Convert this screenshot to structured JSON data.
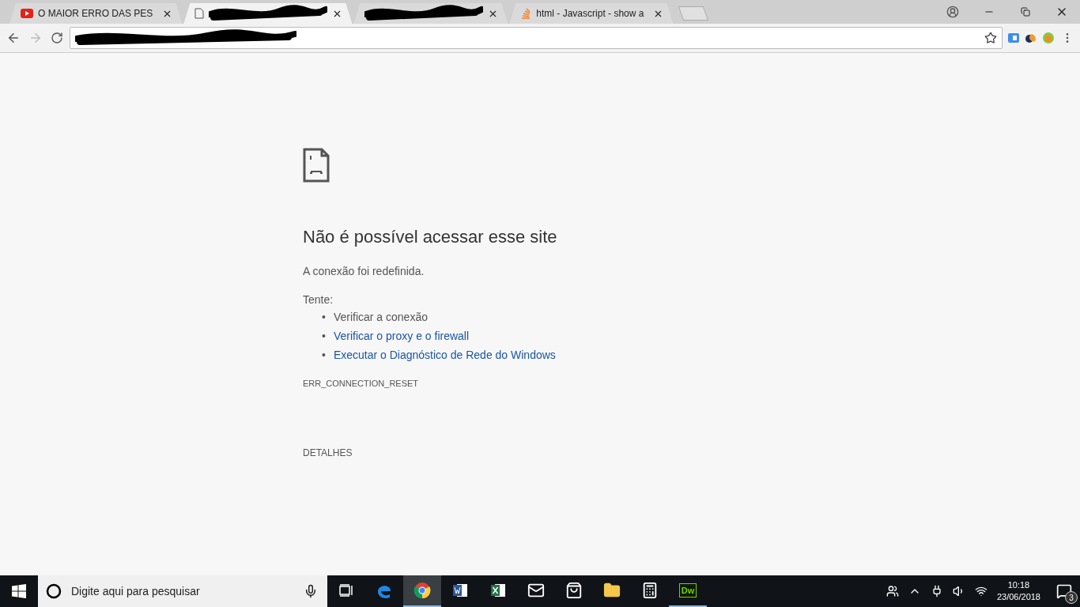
{
  "tabs": [
    {
      "kind": "video",
      "title": "O MAIOR ERRO DAS PES",
      "selected": false
    },
    {
      "kind": "redacted-doc",
      "selected": true
    },
    {
      "kind": "redacted",
      "selected": false
    },
    {
      "kind": "stack",
      "title": "html - Javascript - show a",
      "selected": false
    }
  ],
  "address_bar": {
    "redacted": true
  },
  "error_page": {
    "title": "Não é possível acessar esse site",
    "message": "A conexão foi redefinida.",
    "try_label": "Tente:",
    "suggestions": [
      {
        "kind": "text",
        "marker": "•",
        "text": "Verificar a conexão"
      },
      {
        "kind": "link",
        "marker": "•",
        "text": "Verificar o proxy e o firewall"
      },
      {
        "kind": "link",
        "marker": "•",
        "text": "Executar o Diagnóstico de Rede do Windows"
      }
    ],
    "code": "ERR_CONNECTION_RESET",
    "details_button": "DETALHES"
  },
  "taskbar": {
    "search_placeholder": "Digite aqui para pesquisar",
    "apps": [
      {
        "kind": "taskview",
        "active": false,
        "running": false
      },
      {
        "kind": "edge",
        "active": false,
        "running": false
      },
      {
        "kind": "chrome",
        "active": true,
        "running": true
      },
      {
        "kind": "word",
        "active": false,
        "running": false
      },
      {
        "kind": "excel",
        "active": false,
        "running": false
      },
      {
        "kind": "mail",
        "active": false,
        "running": false
      },
      {
        "kind": "store",
        "active": false,
        "running": false
      },
      {
        "kind": "explorer",
        "active": false,
        "running": false
      },
      {
        "kind": "calculator",
        "active": false,
        "running": false
      },
      {
        "kind": "dreamweaver",
        "label": "Dw",
        "active": false,
        "running": true
      }
    ],
    "time": "10:18",
    "date": "23/06/2018",
    "notifications": "3"
  }
}
